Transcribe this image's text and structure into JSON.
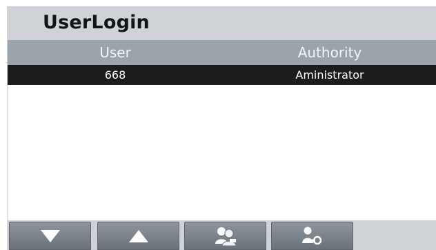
{
  "title": "UserLogin",
  "table": {
    "headers": {
      "user": "User",
      "authority": "Authority"
    },
    "rows": [
      {
        "user": "668",
        "authority": "Aministrator",
        "selected": true
      }
    ]
  },
  "toolbar": {
    "buttons": [
      {
        "icon": "arrow-down-icon"
      },
      {
        "icon": "arrow-up-icon"
      },
      {
        "icon": "users-login-icon"
      },
      {
        "icon": "user-key-icon"
      }
    ]
  },
  "colors": {
    "title_bar": "#cfd2d6",
    "header": "#9ba3ab",
    "selected_row": "#1c1c1c",
    "button": "#7d858c"
  }
}
